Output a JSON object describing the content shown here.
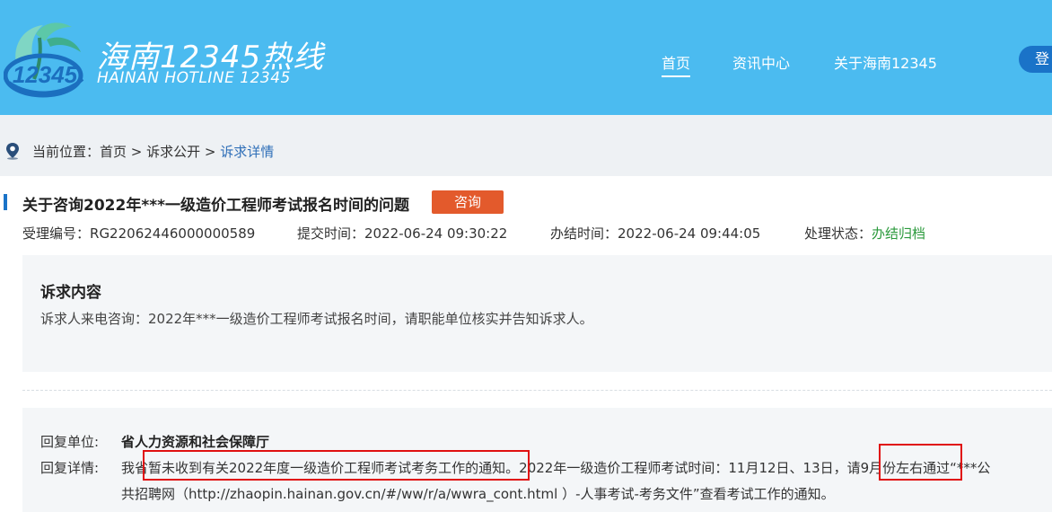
{
  "header": {
    "logo_number": "12345",
    "brand_cn": "海南12345热线",
    "brand_en": "HAINAN HOTLINE 12345",
    "nav": [
      {
        "label": "首页",
        "active": true
      },
      {
        "label": "资讯中心",
        "active": false
      },
      {
        "label": "关于海南12345",
        "active": false
      }
    ],
    "login_label": "登"
  },
  "breadcrumb": {
    "prefix": "当前位置：",
    "home": "首页",
    "sep": " > ",
    "section": "诉求公开",
    "current": "诉求详情"
  },
  "case": {
    "title": "关于咨询2022年***一级造价工程师考试报名时间的问题",
    "tag": "咨询",
    "id_label": "受理编号：",
    "id_value": "RG22062446000000589",
    "submit_label": "提交时间：",
    "submit_value": "2022-06-24 09:30:22",
    "done_label": "办结时间：",
    "done_value": "2022-06-24 09:44:05",
    "status_label": "处理状态：",
    "status_value": "办结归档"
  },
  "request": {
    "heading": "诉求内容",
    "text": "诉求人来电咨询：2022年***一级造价工程师考试报名时间，请职能单位核实并告知诉求人。"
  },
  "reply": {
    "unit_label": "回复单位:",
    "unit_value": "省人力资源和社会保障厅",
    "detail_label": "回复详情:",
    "line1": "我省暂未收到有关2022年度一级造价工程师考试考务工作的通知。2022年一级造价工程师考试时间：11月12日、13日，请9月份左右通过“***公",
    "line2": "共招聘网（http://zhaopin.hainan.gov.cn/#/ww/r/a/wwra_cont.html ）-人事考试-考务文件”查看考试工作的通知。"
  },
  "colors": {
    "header_bg": "#4bbbf0",
    "accent_blue": "#1a73c8",
    "tag_orange": "#e35a2c",
    "status_green": "#2b9a3c",
    "highlight_red": "#e01010"
  },
  "icons": {
    "logo": "hotline-logo-icon",
    "location": "location-pin-icon"
  }
}
